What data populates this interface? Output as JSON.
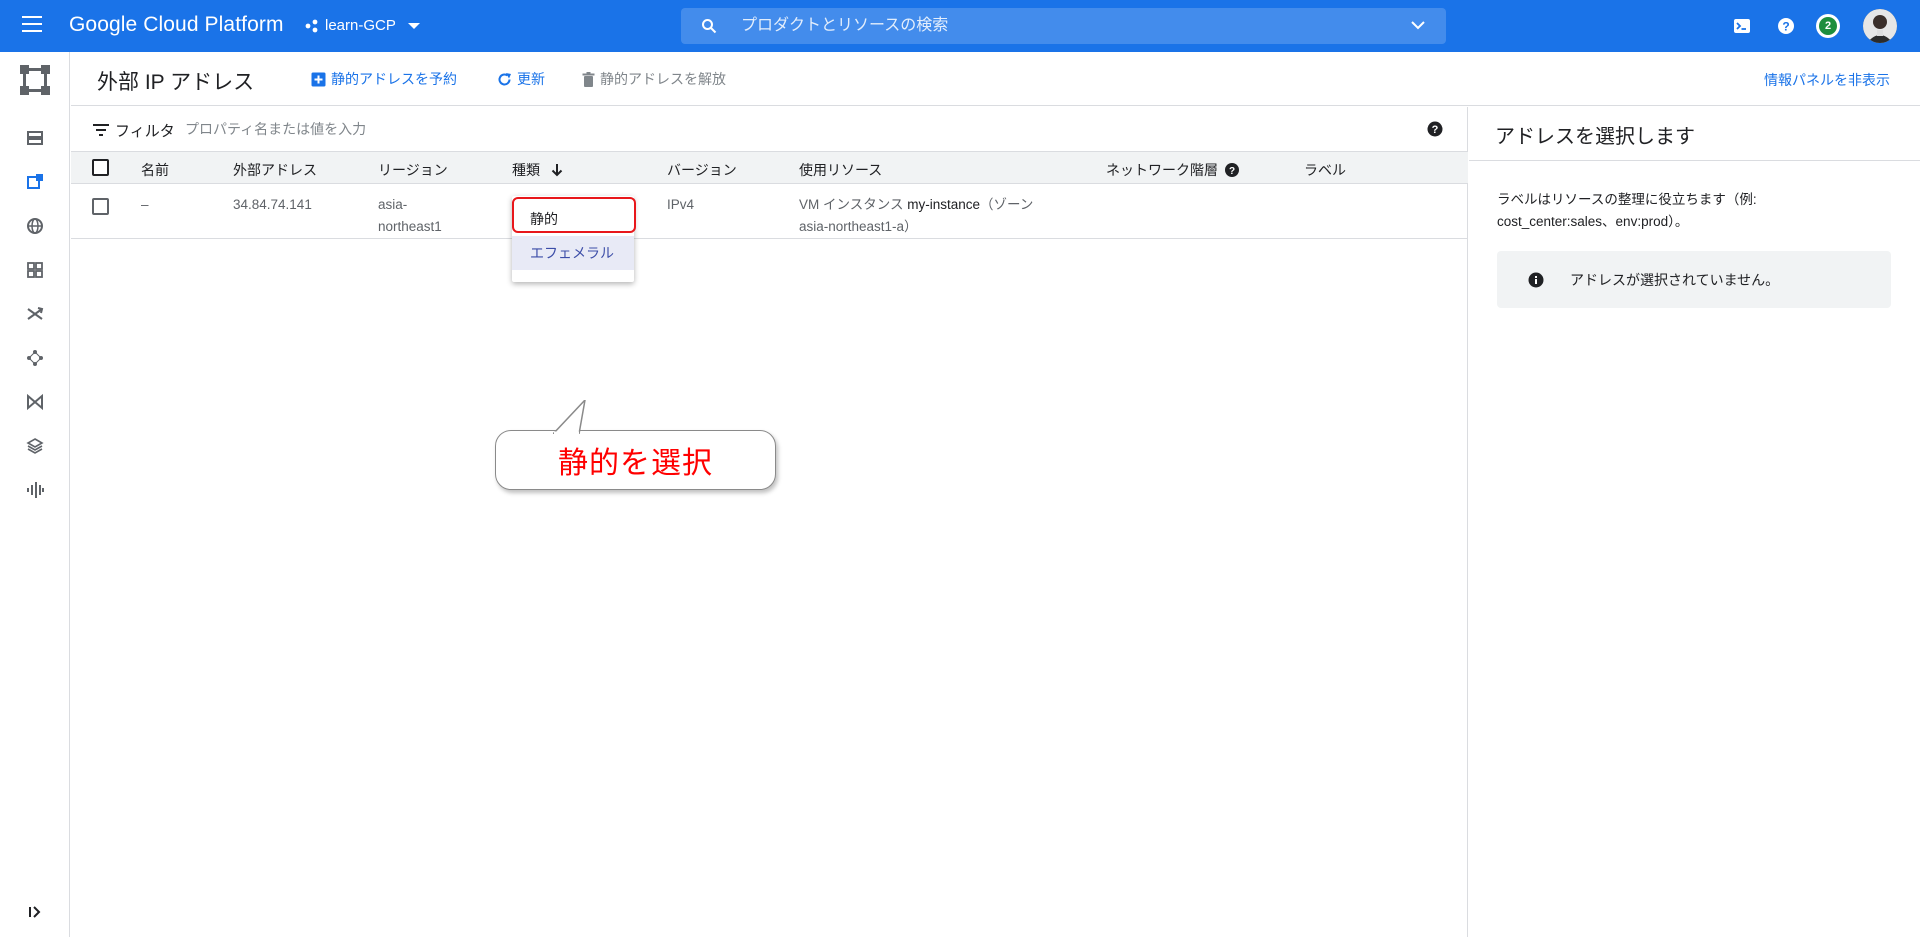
{
  "topbar": {
    "brand": "Google Cloud Platform",
    "project": "learn-GCP",
    "search_placeholder": "プロダクトとリソースの検索",
    "notification_count": "2",
    "icons": [
      "menu-icon",
      "project-dots-icon",
      "search-icon",
      "chevron-down-icon",
      "terminal-icon",
      "help-icon",
      "notification-icon",
      "more-vert-icon",
      "avatar"
    ]
  },
  "leftnav": {
    "icons": [
      "vpc-logo-icon",
      "vpc-networks-icon",
      "external-ip-icon",
      "firewall-icon",
      "routes-icon",
      "vpc-peering-icon",
      "shared-vpc-icon",
      "serverless-connector-icon",
      "packet-mirroring-icon",
      "network-analyzer-icon",
      "expand-icon"
    ]
  },
  "pageheader": {
    "title": "外部 IP アドレス",
    "reserve_label": "静的アドレスを予約",
    "refresh_label": "更新",
    "release_label": "静的アドレスを解放",
    "hide_panel_label": "情報パネルを非表示"
  },
  "filter": {
    "label": "フィルタ",
    "placeholder": "プロパティ名または値を入力"
  },
  "table": {
    "headers": {
      "name": "名前",
      "address": "外部アドレス",
      "region": "リージョン",
      "type": "種類",
      "version": "バージョン",
      "used_by": "使用リソース",
      "tier": "ネットワーク階層",
      "labels": "ラベル"
    },
    "rows": [
      {
        "name": "–",
        "address": "34.84.74.141",
        "region_line1": "asia-",
        "region_line2": "northeast1",
        "version": "IPv4",
        "used_by_prefix": "VM インスタンス ",
        "used_by_instance": "my-instance",
        "used_by_suffix": "（ゾーン",
        "used_by_line2": "asia-northeast1-a）"
      }
    ]
  },
  "type_dropdown": {
    "options": [
      "静的",
      "エフェメラル"
    ],
    "highlighted": "静的"
  },
  "callout": {
    "text": "静的を選択"
  },
  "rightpanel": {
    "title": "アドレスを選択します",
    "description": "ラベルはリソースの整理に役立ちます（例: cost_center:sales、env:prod）。",
    "info": "アドレスが選択されていません。"
  },
  "colors": {
    "topbar": "#1a73e8",
    "accent": "#1a73e8",
    "highlight_border": "#e8171b",
    "callout_text": "#ff0000"
  }
}
